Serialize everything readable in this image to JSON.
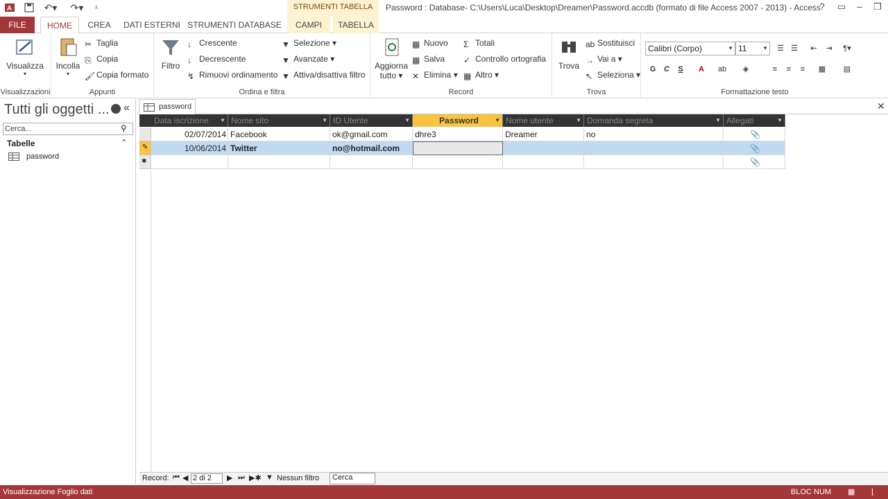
{
  "window": {
    "title": "Password : Database- C:\\Users\\Luca\\Desktop\\Dreamer\\Password.accdb (formato di file Access 2007 - 2013) - Access",
    "context_group": "STRUMENTI TABELLA",
    "help": "?"
  },
  "tabs": {
    "file": "FILE",
    "home": "HOME",
    "crea": "CREA",
    "dati_esterni": "DATI ESTERNI",
    "strumenti_database": "STRUMENTI DATABASE",
    "campi": "CAMPI",
    "tabella": "TABELLA"
  },
  "ribbon": {
    "visualizzazioni": {
      "label": "Visualizzazioni",
      "visualizza": "Visualizza"
    },
    "appunti": {
      "label": "Appunti",
      "incolla": "Incolla",
      "taglia": "Taglia",
      "copia": "Copia",
      "copia_formato": "Copia formato"
    },
    "ordina": {
      "label": "Ordina e filtra",
      "filtro": "Filtro",
      "crescente": "Crescente",
      "decrescente": "Decrescente",
      "rimuovi": "Rimuovi ordinamento",
      "selezione": "Selezione",
      "avanzate": "Avanzate",
      "attiva": "Attiva/disattiva filtro"
    },
    "record": {
      "label": "Record",
      "aggiorna": "Aggiorna",
      "aggiorna2": "tutto",
      "nuovo": "Nuovo",
      "salva": "Salva",
      "elimina": "Elimina",
      "totali": "Totali",
      "controllo": "Controllo ortografia",
      "altro": "Altro"
    },
    "trova": {
      "label": "Trova",
      "trova": "Trova",
      "sostituisci": "Sostituisci",
      "vai": "Vai a",
      "seleziona": "Seleziona"
    },
    "formattazione": {
      "label": "Formattazione testo",
      "font": "Calibri (Corpo)",
      "size": "11",
      "bold": "G",
      "italic": "C",
      "underline": "S"
    }
  },
  "nav": {
    "title": "Tutti gli oggetti ...",
    "search_placeholder": "Cerca...",
    "section": "Tabelle",
    "items": [
      "password"
    ]
  },
  "doc_tab": "password",
  "grid": {
    "headers": [
      "Data iscrizione",
      "Nome sito",
      "ID Utente",
      "Password",
      "Nome utente",
      "Domanda segreta",
      "Allegati"
    ],
    "rows": [
      [
        "02/07/2014",
        "Facebook",
        "ok@gmail.com",
        "dhre3",
        "Dreamer",
        "no"
      ],
      [
        "10/06/2014",
        "Twitter",
        "no@hotmail.com",
        "",
        "",
        ""
      ]
    ]
  },
  "recnav": {
    "label": "Record:",
    "position": "2 di 2",
    "filter": "Nessun filtro",
    "search": "Cerca"
  },
  "status": {
    "left": "Visualizzazione Foglio dati",
    "right": "BLOC NUM"
  },
  "colors": {
    "accent": "#a4373a",
    "header": "#333333",
    "selected_header": "#f7c342",
    "selected_row": "#c2d9f2"
  }
}
